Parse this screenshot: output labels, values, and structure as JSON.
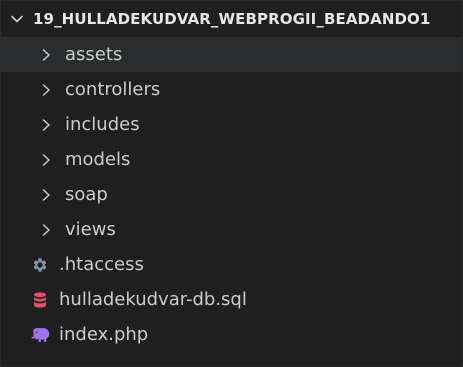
{
  "explorer": {
    "root_label": "19_HULLADEKUDVAR_WEBPROGII_BEADANDO1",
    "folders": [
      {
        "label": "assets"
      },
      {
        "label": "controllers"
      },
      {
        "label": "includes"
      },
      {
        "label": "models"
      },
      {
        "label": "soap"
      },
      {
        "label": "views"
      }
    ],
    "files": [
      {
        "label": ".htaccess",
        "icon": "gear-icon"
      },
      {
        "label": "hulladekudvar-db.sql",
        "icon": "database-icon"
      },
      {
        "label": "index.php",
        "icon": "php-elephant-icon"
      }
    ]
  },
  "colors": {
    "background": "#1f1f1f",
    "selected_row": "#2a2d2e",
    "text": "#cccccc",
    "gear_icon": "#7f94a3",
    "database_icon": "#f14c6e",
    "php_icon": "#a173e8"
  }
}
